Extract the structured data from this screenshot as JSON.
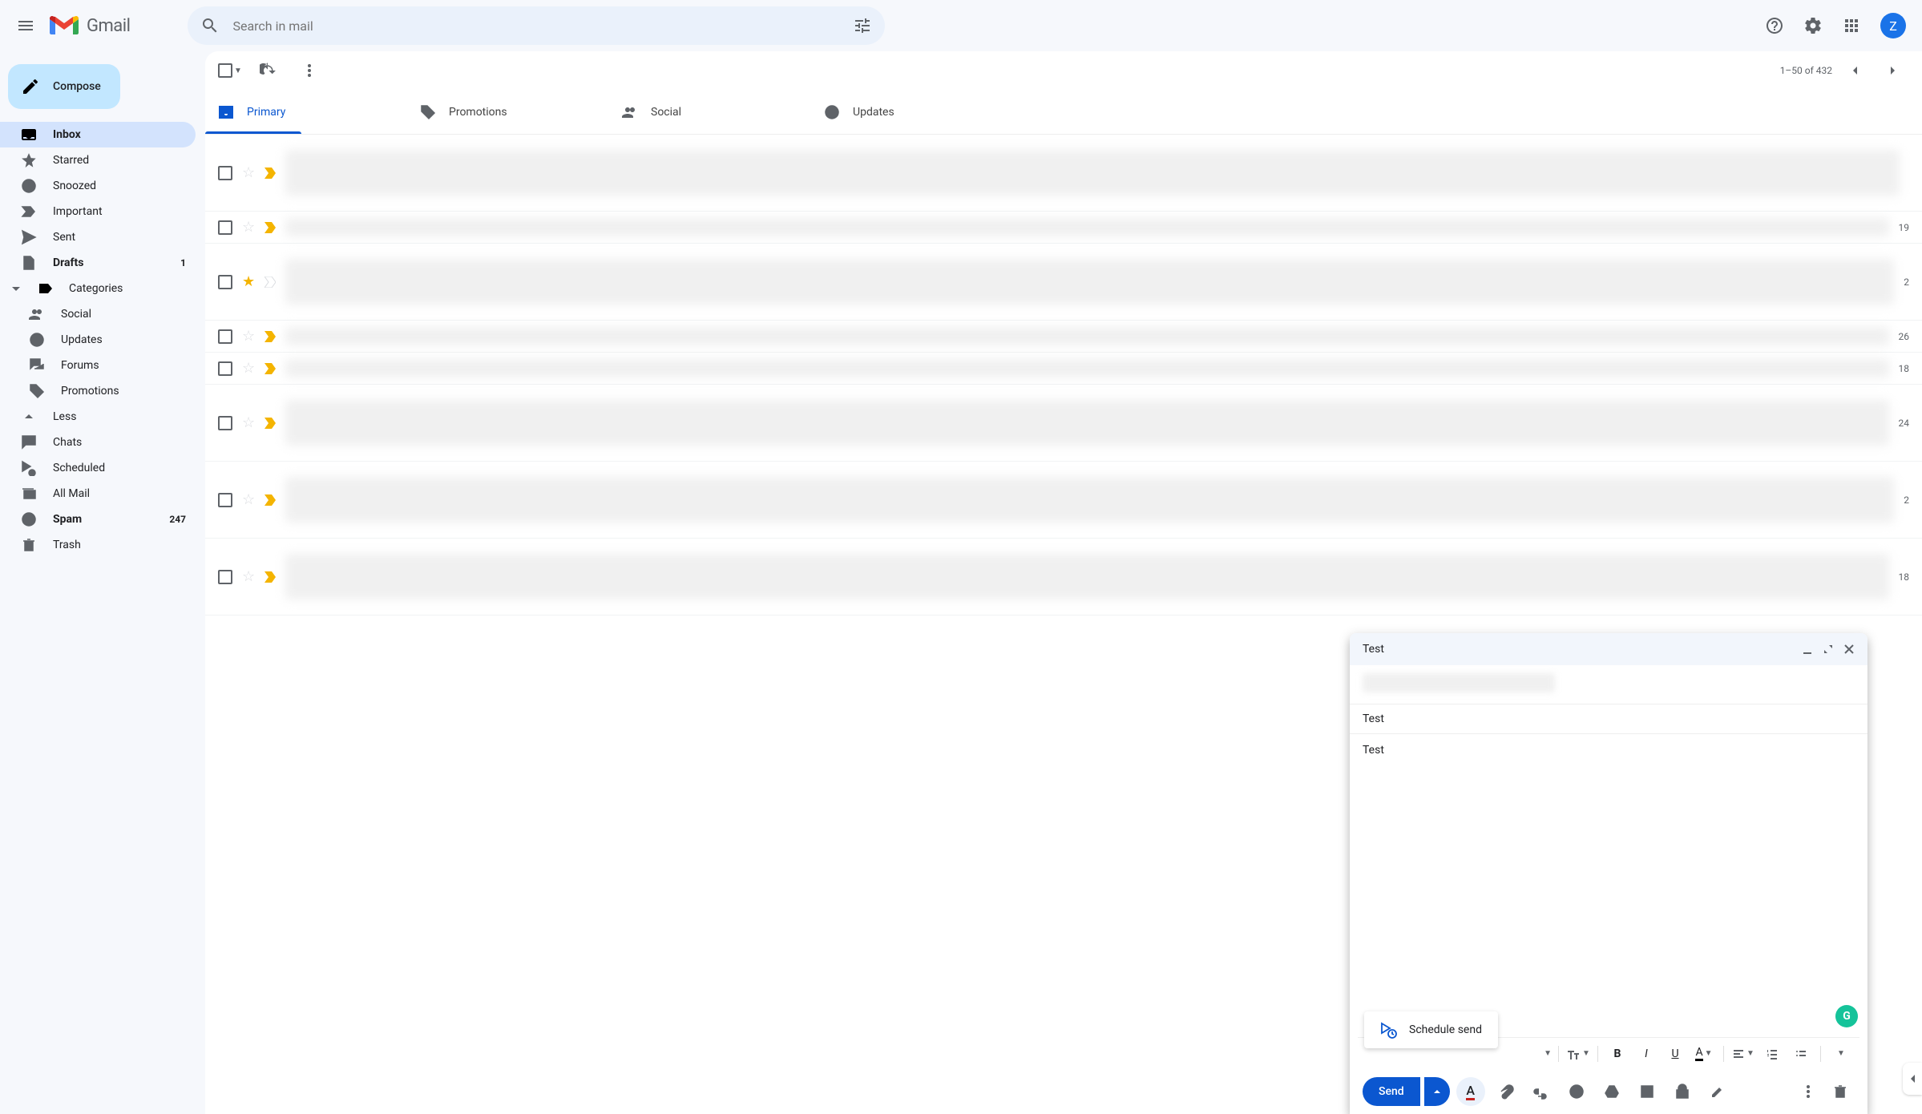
{
  "header": {
    "app_name": "Gmail",
    "search_placeholder": "Search in mail",
    "avatar_letter": "Z"
  },
  "compose_button": "Compose",
  "sidebar": {
    "items": [
      {
        "label": "Inbox",
        "count": ""
      },
      {
        "label": "Starred"
      },
      {
        "label": "Snoozed"
      },
      {
        "label": "Important"
      },
      {
        "label": "Sent"
      },
      {
        "label": "Drafts",
        "count": "1"
      },
      {
        "label": "Categories"
      },
      {
        "label": "Social"
      },
      {
        "label": "Updates"
      },
      {
        "label": "Forums"
      },
      {
        "label": "Promotions"
      },
      {
        "label": "Less"
      },
      {
        "label": "Chats"
      },
      {
        "label": "Scheduled"
      },
      {
        "label": "All Mail"
      },
      {
        "label": "Spam",
        "count": "247"
      },
      {
        "label": "Trash"
      }
    ]
  },
  "toolbar": {
    "page_range": "1–50 of 432"
  },
  "tabs": {
    "primary": "Primary",
    "promotions": "Promotions",
    "social": "Social",
    "updates": "Updates"
  },
  "mail_dates": [
    "",
    "19",
    "2",
    "",
    "26",
    "18",
    "24",
    "2",
    "18"
  ],
  "compose_window": {
    "title": "Test",
    "subject": "Test",
    "body": "Test",
    "send_label": "Send",
    "schedule_label": "Schedule send"
  },
  "grammarly_letter": "G"
}
